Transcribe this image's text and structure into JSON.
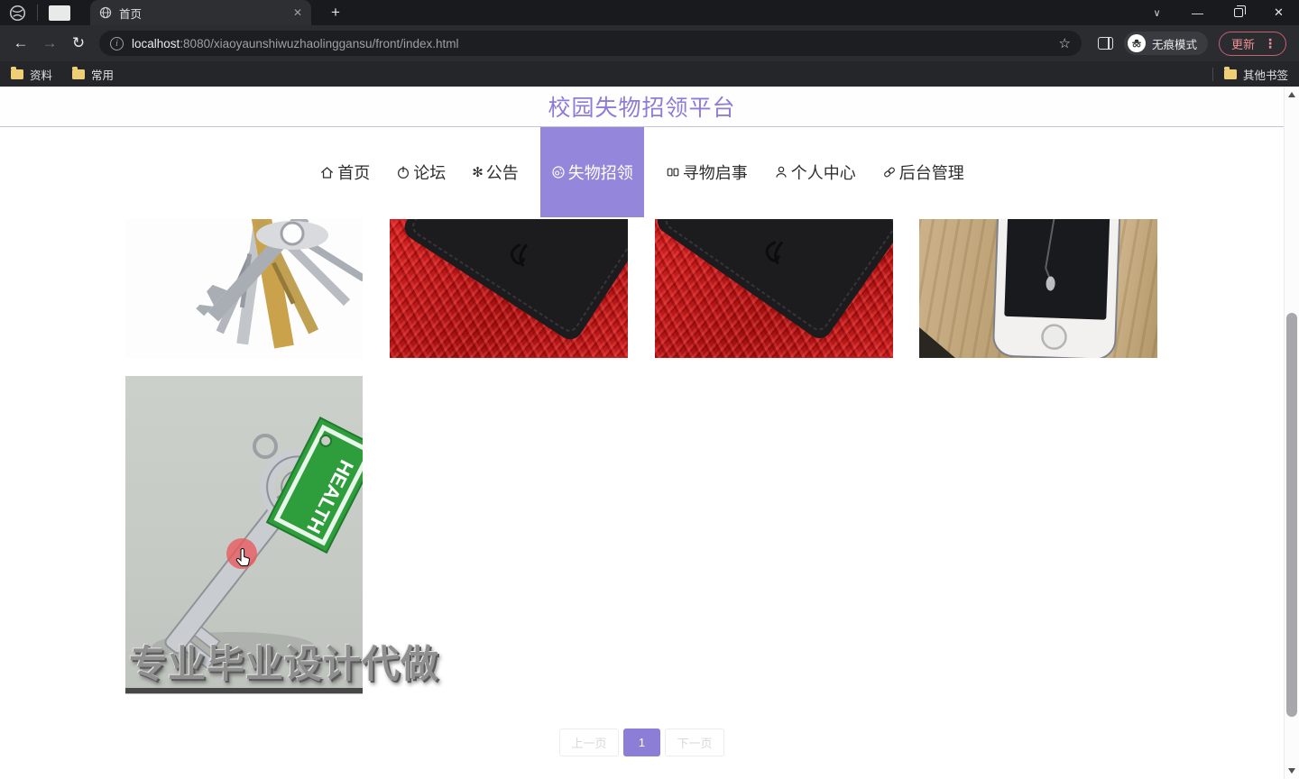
{
  "browser": {
    "tab_title": "首页",
    "url_host": "localhost",
    "url_path": ":8080/xiaoyaunshiwuzhaolinggansu/front/index.html",
    "incognito_label": "无痕模式",
    "update_label": "更新",
    "bookmarks": [
      {
        "label": "资料"
      },
      {
        "label": "常用"
      }
    ],
    "other_bookmarks_label": "其他书签"
  },
  "icons": {
    "close": "✕",
    "tab_close": "✕",
    "plus": "+",
    "chevron_down": "∨",
    "minimize": "—",
    "menu_dots": "⋮",
    "star": "☆",
    "back": "←",
    "forward": "→",
    "reload": "↻",
    "info": "i",
    "announcement_glyph": "✻"
  },
  "page": {
    "title": "校园失物招领平台",
    "nav": [
      {
        "label": "首页",
        "icon": "home-icon",
        "active": false
      },
      {
        "label": "论坛",
        "icon": "forum-icon",
        "active": false
      },
      {
        "label": "公告",
        "icon": "announcement-icon",
        "active": false
      },
      {
        "label": "失物招领",
        "icon": "lost-found-icon",
        "active": true
      },
      {
        "label": "寻物启事",
        "icon": "seek-notice-icon",
        "active": false
      },
      {
        "label": "个人中心",
        "icon": "user-icon",
        "active": false
      },
      {
        "label": "后台管理",
        "icon": "admin-link-icon",
        "active": false
      }
    ],
    "photos": [
      {
        "name": "keys-photo"
      },
      {
        "name": "wallet-photo"
      },
      {
        "name": "wallet-photo"
      },
      {
        "name": "phone-photo"
      },
      {
        "name": "key-health-tag-photo"
      }
    ],
    "tag_text": "HEALTH",
    "watermark": "专业毕业设计代做",
    "pagination": {
      "prev": "上一页",
      "current": "1",
      "next": "下一页"
    },
    "colors": {
      "accent_nav": "#9486db",
      "title_purple": "#8e7cd8",
      "pagination_active": "#8c7ed6",
      "update_red": "#ee8f93"
    }
  }
}
